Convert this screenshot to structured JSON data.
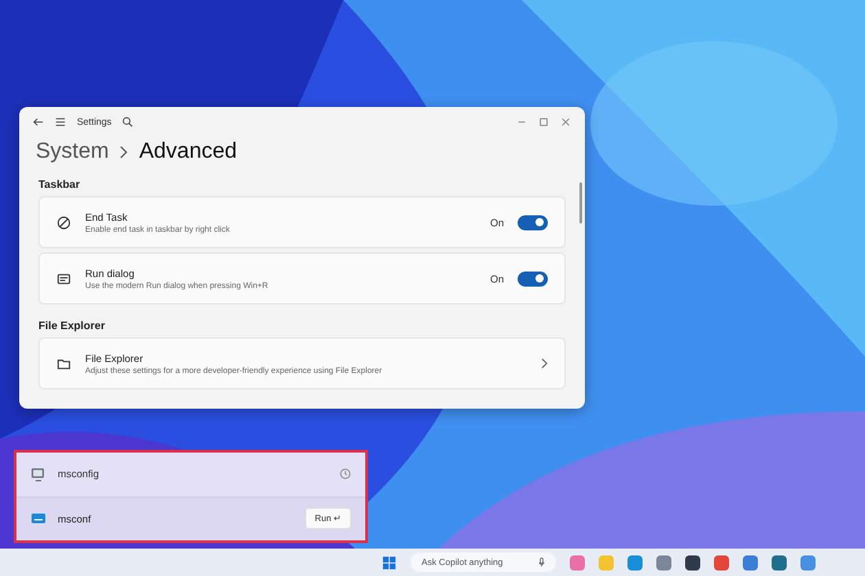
{
  "window": {
    "title": "Settings",
    "breadcrumb": [
      "System",
      "Advanced"
    ]
  },
  "sections": [
    {
      "title": "Taskbar",
      "items": [
        {
          "kind": "toggle",
          "title": "End Task",
          "description": "Enable end task in taskbar by right click",
          "state_text": "On",
          "on": true
        },
        {
          "kind": "toggle",
          "title": "Run dialog",
          "description": "Use the modern Run dialog when pressing Win+R",
          "state_text": "On",
          "on": true
        }
      ]
    },
    {
      "title": "File Explorer",
      "items": [
        {
          "kind": "link",
          "title": "File Explorer",
          "description": "Adjust these settings for a more developer-friendly experience using File Explorer"
        }
      ]
    }
  ],
  "run_dialog": {
    "history": [
      {
        "text": "msconfig"
      }
    ],
    "input": {
      "value": "msconf"
    },
    "run_button": {
      "label": "Run",
      "glyph": "↵"
    }
  },
  "taskbar": {
    "search": {
      "placeholder": "Ask Copilot anything"
    }
  }
}
